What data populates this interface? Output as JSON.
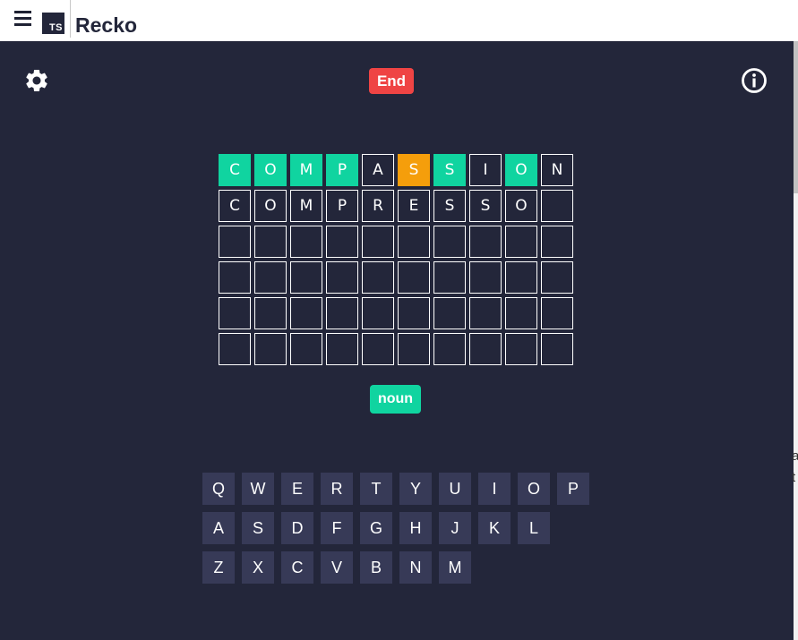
{
  "header": {
    "logo_text": "TS",
    "title": "Recko"
  },
  "toolbar": {
    "end_label": "End",
    "settings_icon": "gear-icon",
    "info_icon": "info-icon"
  },
  "board": {
    "rows": [
      [
        {
          "letter": "C",
          "state": "correct"
        },
        {
          "letter": "O",
          "state": "correct"
        },
        {
          "letter": "M",
          "state": "correct"
        },
        {
          "letter": "P",
          "state": "correct"
        },
        {
          "letter": "A",
          "state": "absent"
        },
        {
          "letter": "S",
          "state": "present"
        },
        {
          "letter": "S",
          "state": "correct"
        },
        {
          "letter": "I",
          "state": "absent"
        },
        {
          "letter": "O",
          "state": "correct"
        },
        {
          "letter": "N",
          "state": "absent"
        }
      ],
      [
        {
          "letter": "C",
          "state": "entered"
        },
        {
          "letter": "O",
          "state": "entered"
        },
        {
          "letter": "M",
          "state": "entered"
        },
        {
          "letter": "P",
          "state": "entered"
        },
        {
          "letter": "R",
          "state": "entered"
        },
        {
          "letter": "E",
          "state": "entered"
        },
        {
          "letter": "S",
          "state": "entered"
        },
        {
          "letter": "S",
          "state": "entered"
        },
        {
          "letter": "O",
          "state": "entered"
        },
        {
          "letter": "",
          "state": "empty"
        }
      ],
      [
        {
          "letter": "",
          "state": "empty"
        },
        {
          "letter": "",
          "state": "empty"
        },
        {
          "letter": "",
          "state": "empty"
        },
        {
          "letter": "",
          "state": "empty"
        },
        {
          "letter": "",
          "state": "empty"
        },
        {
          "letter": "",
          "state": "empty"
        },
        {
          "letter": "",
          "state": "empty"
        },
        {
          "letter": "",
          "state": "empty"
        },
        {
          "letter": "",
          "state": "empty"
        },
        {
          "letter": "",
          "state": "empty"
        }
      ],
      [
        {
          "letter": "",
          "state": "empty"
        },
        {
          "letter": "",
          "state": "empty"
        },
        {
          "letter": "",
          "state": "empty"
        },
        {
          "letter": "",
          "state": "empty"
        },
        {
          "letter": "",
          "state": "empty"
        },
        {
          "letter": "",
          "state": "empty"
        },
        {
          "letter": "",
          "state": "empty"
        },
        {
          "letter": "",
          "state": "empty"
        },
        {
          "letter": "",
          "state": "empty"
        },
        {
          "letter": "",
          "state": "empty"
        }
      ],
      [
        {
          "letter": "",
          "state": "empty"
        },
        {
          "letter": "",
          "state": "empty"
        },
        {
          "letter": "",
          "state": "empty"
        },
        {
          "letter": "",
          "state": "empty"
        },
        {
          "letter": "",
          "state": "empty"
        },
        {
          "letter": "",
          "state": "empty"
        },
        {
          "letter": "",
          "state": "empty"
        },
        {
          "letter": "",
          "state": "empty"
        },
        {
          "letter": "",
          "state": "empty"
        },
        {
          "letter": "",
          "state": "empty"
        }
      ],
      [
        {
          "letter": "",
          "state": "empty"
        },
        {
          "letter": "",
          "state": "empty"
        },
        {
          "letter": "",
          "state": "empty"
        },
        {
          "letter": "",
          "state": "empty"
        },
        {
          "letter": "",
          "state": "empty"
        },
        {
          "letter": "",
          "state": "empty"
        },
        {
          "letter": "",
          "state": "empty"
        },
        {
          "letter": "",
          "state": "empty"
        },
        {
          "letter": "",
          "state": "empty"
        },
        {
          "letter": "",
          "state": "empty"
        }
      ]
    ]
  },
  "hint": {
    "label": "noun"
  },
  "keyboard": {
    "rows": [
      [
        "Q",
        "W",
        "E",
        "R",
        "T",
        "Y",
        "U",
        "I",
        "O",
        "P"
      ],
      [
        "A",
        "S",
        "D",
        "F",
        "G",
        "H",
        "J",
        "K",
        "L"
      ],
      [
        "Z",
        "X",
        "C",
        "V",
        "B",
        "N",
        "M"
      ]
    ]
  },
  "edge_text": [
    "a",
    "t"
  ],
  "colors": {
    "background": "#23263a",
    "correct": "#10d4a0",
    "present": "#f59e0b",
    "end_button": "#ef4444",
    "key": "#373a57"
  }
}
